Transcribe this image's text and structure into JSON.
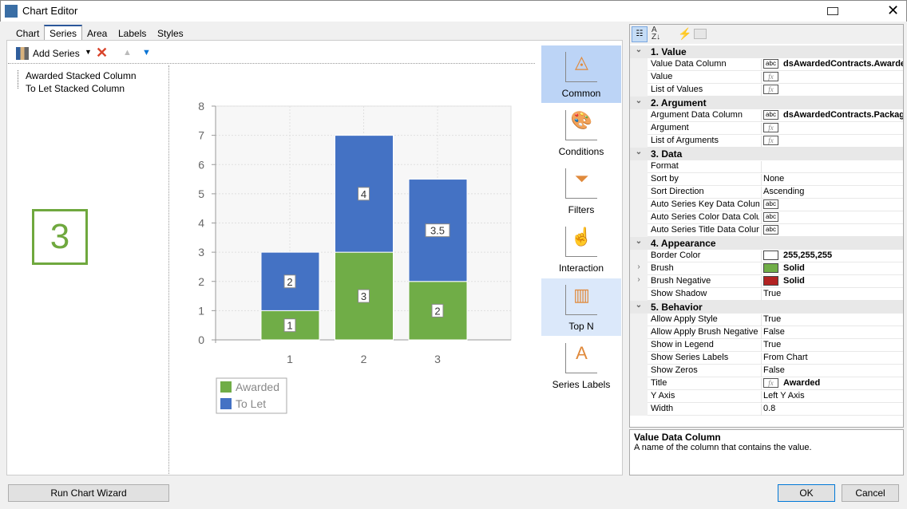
{
  "window": {
    "title": "Chart Editor"
  },
  "tabs": [
    {
      "label": "Chart"
    },
    {
      "label": "Series",
      "active": true
    },
    {
      "label": "Area"
    },
    {
      "label": "Labels"
    },
    {
      "label": "Styles"
    }
  ],
  "toolbar": {
    "add_series": "Add Series"
  },
  "series_tree": [
    "Awarded Stacked Column",
    "To Let Stacked Column"
  ],
  "annotation": "3",
  "gallery": [
    {
      "label": "Common",
      "state": "selected"
    },
    {
      "label": "Conditions"
    },
    {
      "label": "Filters"
    },
    {
      "label": "Interaction"
    },
    {
      "label": "Top N",
      "state": "hover"
    },
    {
      "label": "Series Labels"
    }
  ],
  "chart_data": {
    "type": "bar",
    "stacked": true,
    "categories": [
      "1",
      "2",
      "3"
    ],
    "ylim": [
      0,
      8
    ],
    "yticks": [
      0,
      1,
      2,
      3,
      4,
      5,
      6,
      7,
      8
    ],
    "grid": true,
    "legend": "bottom-left",
    "series": [
      {
        "name": "Awarded",
        "color": "#70ad47",
        "values": [
          1,
          3,
          2
        ]
      },
      {
        "name": "To Let",
        "color": "#4472c4",
        "values": [
          2,
          4,
          3.5
        ]
      }
    ]
  },
  "properties": [
    {
      "cat": "1. Value"
    },
    {
      "n": "Value Data Column",
      "icon": "abc",
      "v": "dsAwardedContracts.Awarded",
      "bold": true
    },
    {
      "n": "Value",
      "icon": "fx",
      "v": ""
    },
    {
      "n": "List of Values",
      "icon": "fx",
      "v": ""
    },
    {
      "cat": "2. Argument"
    },
    {
      "n": "Argument Data Column",
      "icon": "abc",
      "v": "dsAwardedContracts.Package",
      "bold": true
    },
    {
      "n": "Argument",
      "icon": "fx",
      "v": ""
    },
    {
      "n": "List of Arguments",
      "icon": "fx",
      "v": ""
    },
    {
      "cat": "3. Data"
    },
    {
      "n": "Format",
      "v": ""
    },
    {
      "n": "Sort by",
      "v": "None"
    },
    {
      "n": "Sort Direction",
      "v": "Ascending"
    },
    {
      "n": "Auto Series Key Data Column",
      "icon": "abc",
      "v": ""
    },
    {
      "n": "Auto Series Color Data Column",
      "icon": "abc",
      "v": ""
    },
    {
      "n": "Auto Series Title Data Column",
      "icon": "abc",
      "v": ""
    },
    {
      "cat": "4. Appearance"
    },
    {
      "n": "Border Color",
      "swatch": "#ffffff",
      "v": "255,255,255",
      "bold": true
    },
    {
      "n": "Brush",
      "swatch": "#70ad47",
      "v": "Solid",
      "bold": true,
      "expand": true
    },
    {
      "n": "Brush Negative",
      "swatch": "#b22222",
      "v": "Solid",
      "bold": true,
      "expand": true
    },
    {
      "n": "Show Shadow",
      "v": "True"
    },
    {
      "cat": "5. Behavior"
    },
    {
      "n": "Allow Apply Style",
      "v": "True"
    },
    {
      "n": "Allow Apply Brush Negative",
      "v": "False"
    },
    {
      "n": "Show in Legend",
      "v": "True"
    },
    {
      "n": "Show Series Labels",
      "v": "From Chart"
    },
    {
      "n": "Show Zeros",
      "v": "False"
    },
    {
      "n": "Title",
      "icon": "fx",
      "v": "Awarded",
      "bold": true
    },
    {
      "n": "Y Axis",
      "v": "Left Y Axis"
    },
    {
      "n": "Width",
      "v": "0.8"
    }
  ],
  "description": {
    "title": "Value Data Column",
    "text": "A name of the column that contains the value."
  },
  "buttons": {
    "wizard": "Run Chart Wizard",
    "ok": "OK",
    "cancel": "Cancel"
  }
}
